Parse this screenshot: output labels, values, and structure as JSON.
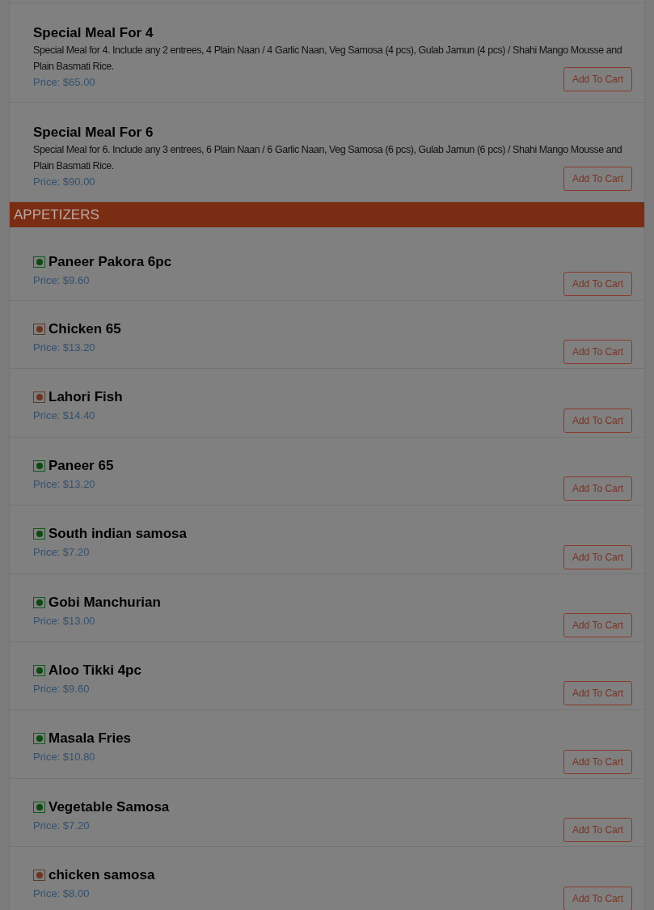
{
  "specials": [
    {
      "name": "Special Meal For 4",
      "description": "Special Meal for 4. Include any 2 entrees, 4 Plain Naan / 4 Garlic Naan, Veg Samosa (4 pcs), Gulab Jamun (4 pcs) / Shahi Mango Mousse and Plain Basmati Rice.",
      "price": "Price: $65.00",
      "button": "Add To Cart"
    },
    {
      "name": "Special Meal For 6",
      "description": "Special Meal for 6. Include any 3 entrees, 6 Plain Naan / 6 Garlic Naan, Veg Samosa (6 pcs), Gulab Jamun (6 pcs) / Shahi Mango Mousse and Plain Basmati Rice.",
      "price": "Price: $90.00",
      "button": "Add To Cart"
    }
  ],
  "category": {
    "title": "APPETIZERS",
    "items": [
      {
        "name": "Paneer Pakora 6pc",
        "kind": "veg",
        "price": "Price: $9.60",
        "button": "Add To Cart"
      },
      {
        "name": "Chicken 65",
        "kind": "non-veg",
        "price": "Price: $13.20",
        "button": "Add To Cart"
      },
      {
        "name": "Lahori Fish",
        "kind": "non-veg",
        "price": "Price: $14.40",
        "button": "Add To Cart"
      },
      {
        "name": "Paneer 65",
        "kind": "veg",
        "price": "Price: $13.20",
        "button": "Add To Cart"
      },
      {
        "name": "South indian samosa",
        "kind": "veg",
        "price": "Price: $7.20",
        "button": "Add To Cart"
      },
      {
        "name": "Gobi Manchurian",
        "kind": "veg",
        "price": "Price: $13.00",
        "button": "Add To Cart"
      },
      {
        "name": "Aloo Tikki 4pc",
        "kind": "veg",
        "price": "Price: $9.60",
        "button": "Add To Cart"
      },
      {
        "name": "Masala Fries",
        "kind": "veg",
        "price": "Price: $10.80",
        "button": "Add To Cart"
      },
      {
        "name": "Vegetable Samosa",
        "kind": "veg",
        "price": "Price: $7.20",
        "button": "Add To Cart"
      },
      {
        "name": "chicken samosa",
        "kind": "non-veg",
        "price": "Price: $8.00",
        "button": "Add To Cart"
      }
    ]
  }
}
